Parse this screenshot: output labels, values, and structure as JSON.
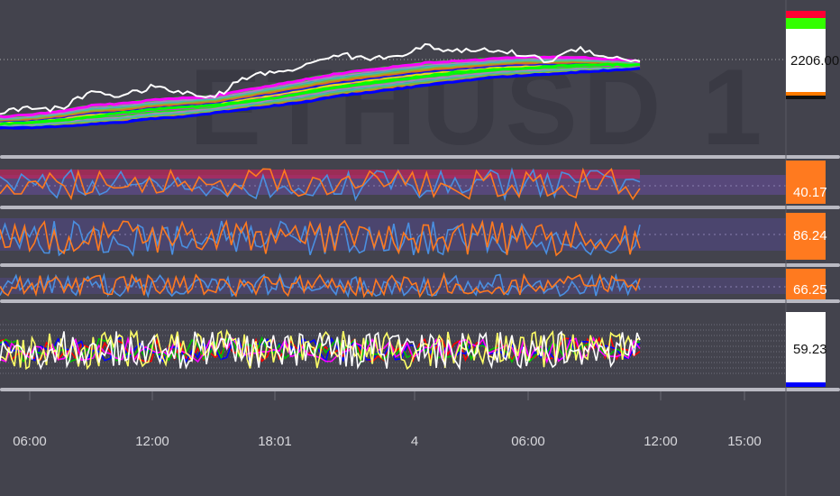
{
  "chart": {
    "watermark": "ETHUSD 1",
    "price_label": "2206.00",
    "time_labels": [
      "06:00",
      "12:00",
      "18:01",
      "4",
      "06:00",
      "12:00",
      "15:00"
    ],
    "colors": {
      "background": "#43434d",
      "separator": "#b9b9c2",
      "axis_text": "#d8d8dc",
      "watermark": "#3a3a44",
      "orange": "#ff7a1f",
      "blue_line": "#4a8fe0",
      "white_line": "#ffffff",
      "purple_band": "#5e4a8a",
      "ribbon": [
        "#0000ff",
        "#ff7f00",
        "#7fbf3f",
        "#3fbfbf",
        "#bf7fbf",
        "#00ff00",
        "#ff00ff",
        "#ffff00"
      ]
    }
  },
  "chart_data": [
    {
      "type": "line",
      "panel": "price",
      "y_label_value": "2206.00",
      "series": [
        {
          "values": [
            2178,
            2181,
            2180,
            2190,
            2187,
            2192,
            2189,
            2186,
            2197,
            2200,
            2203,
            2210,
            2207,
            2209,
            2214,
            2211,
            2212,
            2210,
            2206,
            2213,
            2208,
            2206
          ]
        },
        {
          "values": [
            2176,
            2177,
            2179,
            2182,
            2183,
            2185,
            2186,
            2187,
            2190,
            2193,
            2196,
            2199,
            2201,
            2203,
            2205,
            2206,
            2207,
            2208,
            2208,
            2208,
            2207,
            2206
          ]
        },
        {
          "values": [
            2172,
            2173,
            2174,
            2176,
            2178,
            2180,
            2181,
            2182,
            2184,
            2186,
            2189,
            2192,
            2194,
            2196,
            2198,
            2200,
            2201,
            2202,
            2203,
            2204,
            2204,
            2204
          ]
        },
        {
          "values": [
            2170,
            2170,
            2171,
            2172,
            2173,
            2175,
            2176,
            2178,
            2180,
            2182,
            2184,
            2187,
            2189,
            2191,
            2193,
            2195,
            2197,
            2198,
            2199,
            2200,
            2201,
            2202
          ]
        }
      ]
    },
    {
      "type": "line",
      "panel": "oscillator-1",
      "last_value": "40.17"
    },
    {
      "type": "line",
      "panel": "oscillator-2",
      "last_value": "86.24"
    },
    {
      "type": "line",
      "panel": "oscillator-3",
      "last_value": "66.25"
    },
    {
      "type": "line",
      "panel": "oscillator-4",
      "last_value": "59.23"
    }
  ]
}
